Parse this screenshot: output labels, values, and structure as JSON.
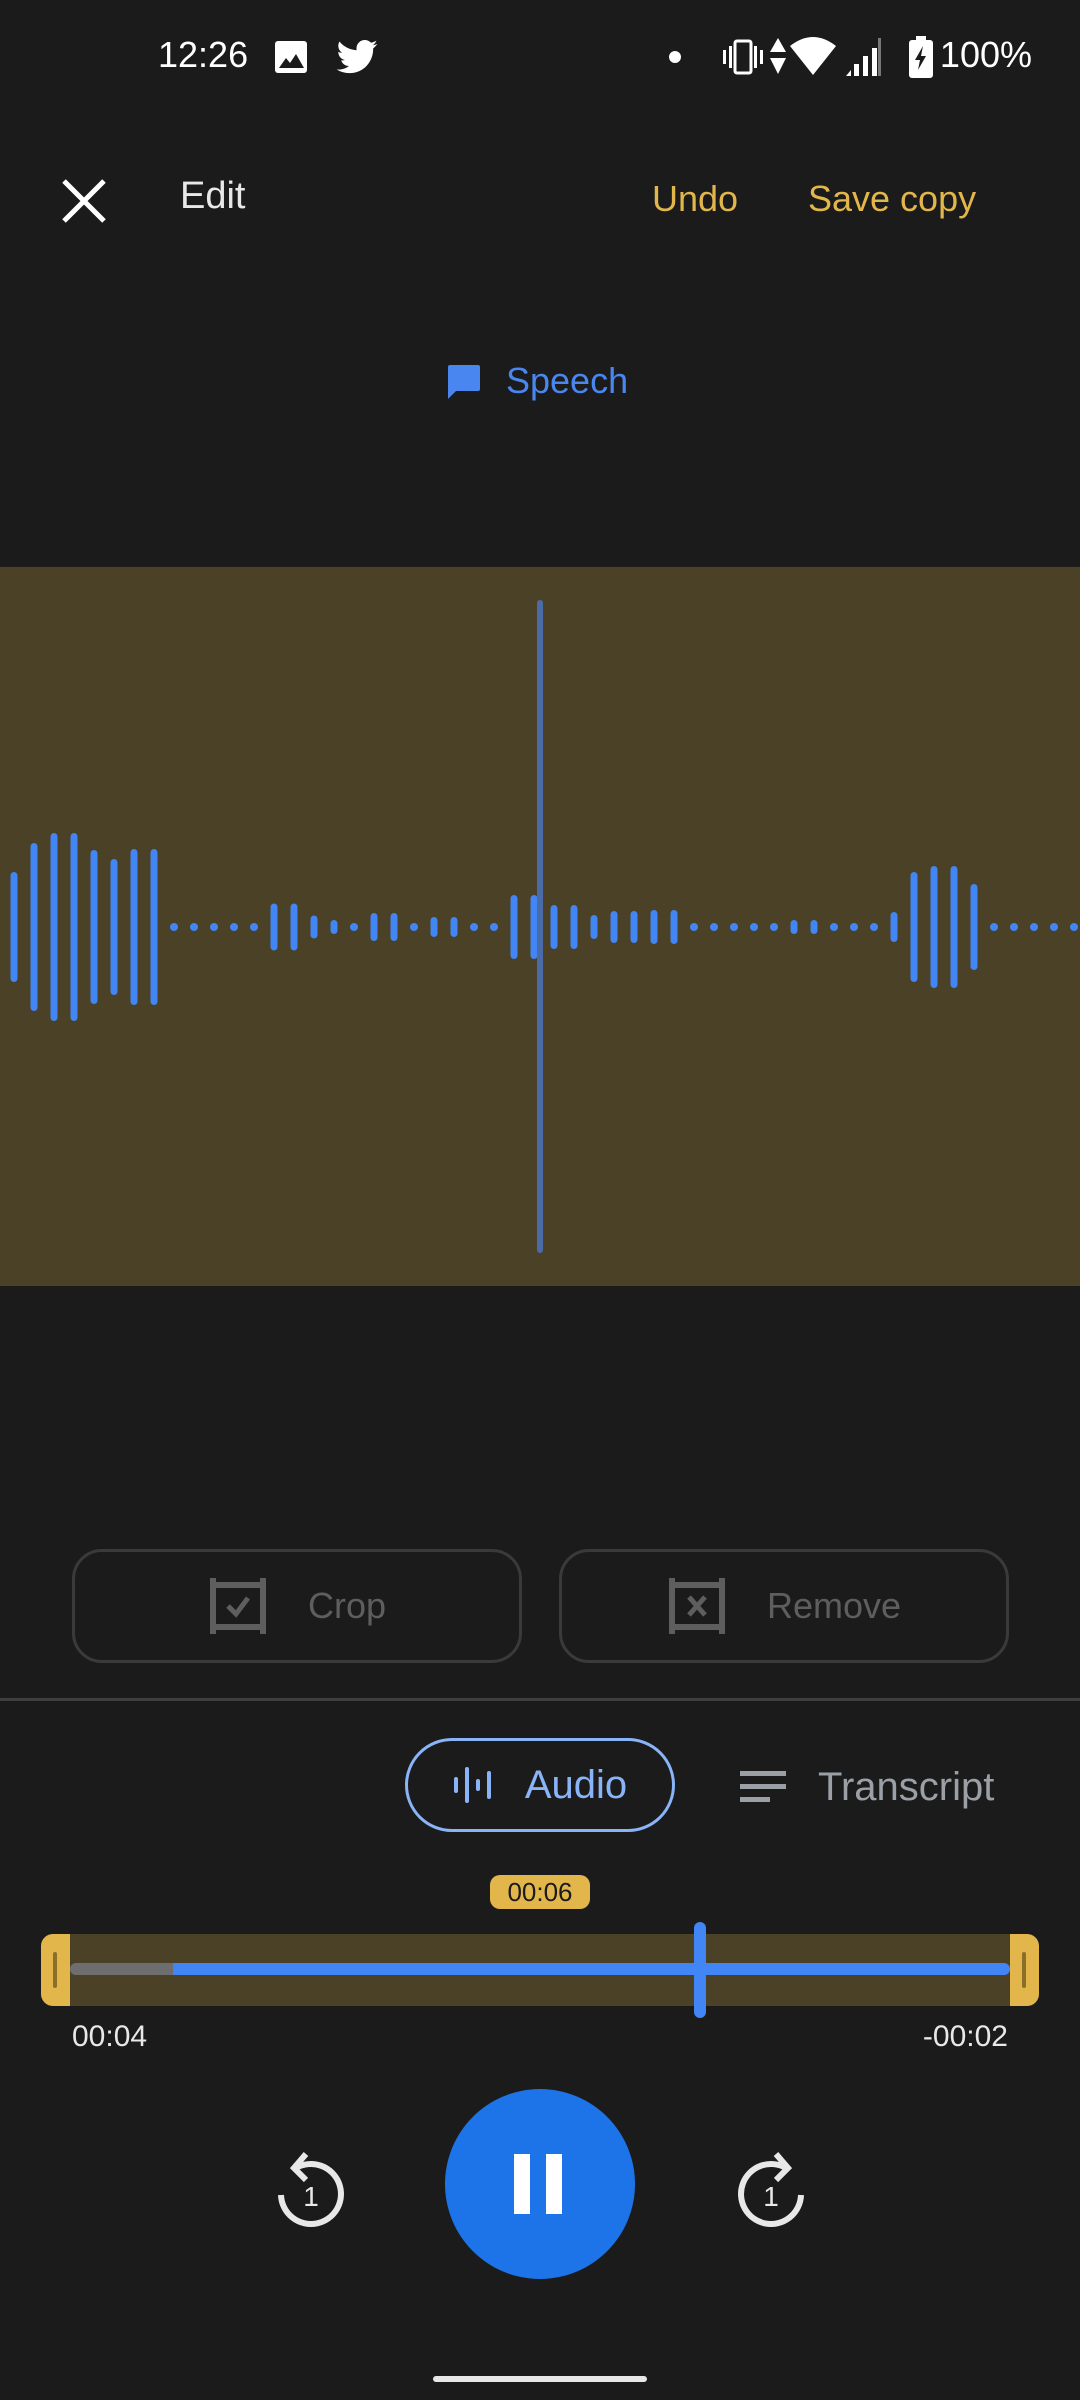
{
  "status_bar": {
    "time": "12:26",
    "left_icons": [
      "gallery-icon",
      "twitter-icon"
    ],
    "right_icons": [
      "notification-dot-icon",
      "vibrate-icon",
      "data-arrows-icon",
      "wifi-icon",
      "cell-signal-icon",
      "battery-charging-icon"
    ],
    "battery": "100%"
  },
  "top_bar": {
    "close_icon": "close-icon",
    "title": "Edit",
    "undo_label": "Undo",
    "save_label": "Save copy"
  },
  "speech": {
    "icon": "speech-bubble-icon",
    "label": "Speech"
  },
  "waveform": {
    "colors": {
      "background": "#4a4127",
      "bars": "#4285f4",
      "playhead": "#4a6ba8"
    },
    "amplitudes": [
      110,
      168,
      188,
      188,
      154,
      136,
      156,
      156,
      0,
      0,
      0,
      0,
      0,
      47,
      47,
      23,
      14,
      0,
      28,
      28,
      0,
      20,
      20,
      0,
      0,
      64,
      64,
      44,
      44,
      24,
      32,
      32,
      34,
      34,
      0,
      0,
      0,
      0,
      0,
      14,
      14,
      0,
      0,
      0,
      30,
      110,
      122,
      122,
      86,
      0,
      0,
      0,
      0,
      0
    ]
  },
  "actions": {
    "crop_label": "Crop",
    "remove_label": "Remove"
  },
  "view_toggle": {
    "audio_label": "Audio",
    "transcript_label": "Transcript",
    "selected": "Audio"
  },
  "timeline": {
    "current_time": "00:06",
    "start_time": "00:04",
    "end_time": "-00:02",
    "played_fraction": 0.11,
    "playhead_fraction": 0.67,
    "colors": {
      "accent": "#e2b64a",
      "track": "#4285f4"
    }
  },
  "playback": {
    "rewind_label": "1",
    "forward_label": "1",
    "state": "playing"
  }
}
